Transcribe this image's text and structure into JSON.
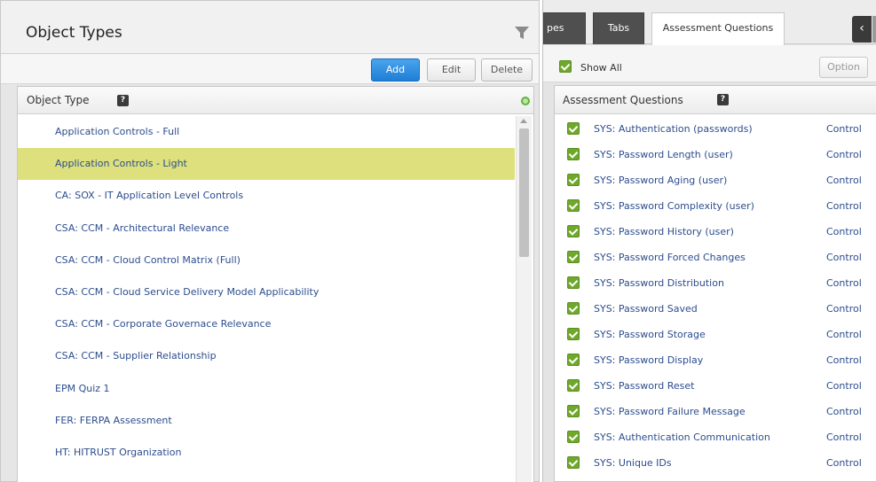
{
  "left": {
    "title": "Object Types",
    "toolbar": {
      "add_label": "Add",
      "edit_label": "Edit",
      "delete_label": "Delete"
    },
    "list_header": "Object Type",
    "help_glyph": "?",
    "rows": [
      {
        "label": "Application Controls - Full"
      },
      {
        "label": "Application Controls - Light"
      },
      {
        "label": "CA: SOX - IT Application Level Controls"
      },
      {
        "label": "CSA: CCM - Architectural Relevance"
      },
      {
        "label": "CSA: CCM - Cloud Control Matrix (Full)"
      },
      {
        "label": "CSA: CCM - Cloud Service Delivery Model Applicability"
      },
      {
        "label": "CSA: CCM - Corporate Governace Relevance"
      },
      {
        "label": "CSA: CCM - Supplier Relationship"
      },
      {
        "label": "EPM Quiz 1"
      },
      {
        "label": "FER: FERPA Assessment"
      },
      {
        "label": "HT: HITRUST Organization"
      }
    ],
    "selected_row": "Application Controls - Light"
  },
  "right": {
    "tabs": [
      {
        "label": "pes"
      },
      {
        "label": "Tabs"
      },
      {
        "label": "Assessment Questions"
      }
    ],
    "tab_arrow": "‹",
    "show_all_label": "Show All",
    "option_label": "Option",
    "list_header": "Assessment Questions",
    "help_glyph": "?",
    "questions": [
      {
        "text": "SYS: Authentication (passwords)",
        "type": "Control"
      },
      {
        "text": "SYS: Password Length (user)",
        "type": "Control"
      },
      {
        "text": "SYS: Password Aging (user)",
        "type": "Control"
      },
      {
        "text": "SYS: Password Complexity (user)",
        "type": "Control"
      },
      {
        "text": "SYS: Password History (user)",
        "type": "Control"
      },
      {
        "text": "SYS: Password Forced Changes",
        "type": "Control"
      },
      {
        "text": "SYS: Password Distribution",
        "type": "Control"
      },
      {
        "text": "SYS: Password Saved",
        "type": "Control"
      },
      {
        "text": "SYS: Password Storage",
        "type": "Control"
      },
      {
        "text": "SYS: Password Display",
        "type": "Control"
      },
      {
        "text": "SYS: Password Reset",
        "type": "Control"
      },
      {
        "text": "SYS: Password Failure Message",
        "type": "Control"
      },
      {
        "text": "SYS: Authentication Communication",
        "type": "Control"
      },
      {
        "text": "SYS: Unique IDs",
        "type": "Control"
      }
    ]
  },
  "colors": {
    "accent_blue": "#1f7fd6",
    "selected_row": "#dde07c",
    "link_text": "#2c4d8e",
    "checkbox_green": "#6fa82a",
    "dark_tab": "#4f4f4f"
  }
}
